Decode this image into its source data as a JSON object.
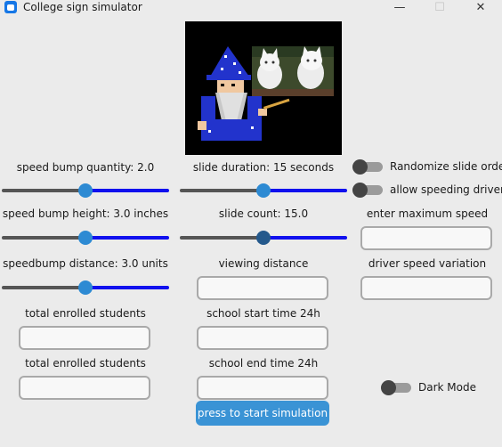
{
  "window": {
    "title": "College sign simulator",
    "controls": {
      "minimize": "—",
      "maximize": "☐",
      "close": "✕"
    }
  },
  "sliders": {
    "bump_quantity": {
      "label": "speed bump quantity: 2.0",
      "value_fraction": 0.5
    },
    "bump_height": {
      "label": "speed bump height: 3.0 inches",
      "value_fraction": 0.5
    },
    "bump_distance": {
      "label": "speedbump distance: 3.0 units",
      "value_fraction": 0.5
    },
    "slide_duration": {
      "label": "slide duration: 15 seconds",
      "value_fraction": 0.5
    },
    "slide_count": {
      "label": "slide count: 15.0",
      "value_fraction": 0.5
    }
  },
  "switches": {
    "randomize": {
      "label": "Randomize slide order",
      "on": false
    },
    "speeding": {
      "label": "allow speeding drivers",
      "on": false
    },
    "dark_mode": {
      "label": "Dark Mode",
      "on": false
    }
  },
  "fields": {
    "enrolled_1": {
      "label": "total enrolled students",
      "value": ""
    },
    "enrolled_2": {
      "label": "total enrolled students",
      "value": ""
    },
    "viewing_distance": {
      "label": "viewing distance",
      "value": ""
    },
    "start_time": {
      "label": "school start time 24h",
      "value": ""
    },
    "end_time": {
      "label": "school end time 24h",
      "value": ""
    },
    "max_speed": {
      "label": "enter maximum speed",
      "value": ""
    },
    "speed_variation": {
      "label": "driver speed variation",
      "value": ""
    }
  },
  "buttons": {
    "start": "press to start simulation"
  },
  "colors": {
    "accent": "#3a93d5",
    "slider_fill": "#1010ee",
    "stage_bg": "#000000"
  },
  "icons": [
    "app-icon",
    "wizard-pixel-art",
    "kitten-photo"
  ]
}
